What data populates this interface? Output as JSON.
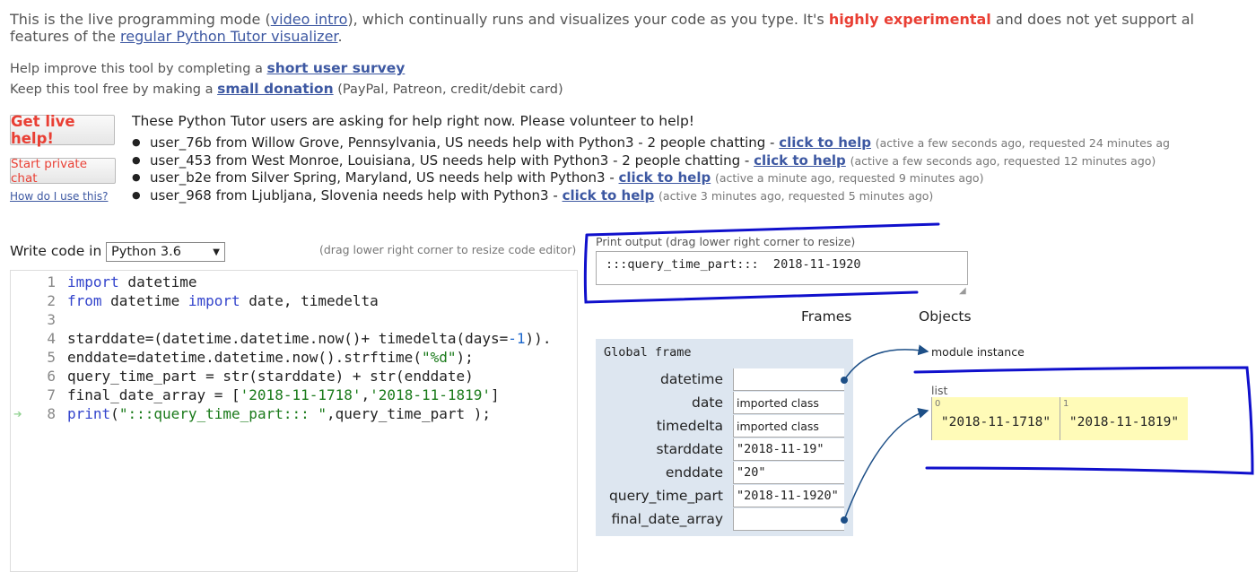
{
  "intro": {
    "prefix": "This is the live programming mode (",
    "video_link": "video intro",
    "mid": "), which continually runs and visualizes your code as you type. It's ",
    "highly": "highly experimental",
    "suffix": " and does not yet support all lang",
    "line2_prefix": "features of the ",
    "regular_link": "regular Python Tutor visualizer",
    "line2_suffix": "."
  },
  "help": {
    "survey_prefix": "Help improve this tool by completing a ",
    "survey_link": "short user survey",
    "donate_prefix": "Keep this tool free by making a ",
    "donate_link": "small donation",
    "donate_suffix": " (PayPal, Patreon, credit/debit card)"
  },
  "sidebar_buttons": {
    "live_help": "Get live help!",
    "private_chat": "Start private chat",
    "howto": "How do I use this?"
  },
  "requests": {
    "heading": "These Python Tutor users are asking for help right now. Please volunteer to help!",
    "link_label": "click to help",
    "items": [
      {
        "text": "user_76b from Willow Grove, Pennsylvania, US needs help with Python3 - 2 people chatting - ",
        "meta": "(active a few seconds ago, requested 24 minutes ag"
      },
      {
        "text": "user_453 from West Monroe, Louisiana, US needs help with Python3 - 2 people chatting - ",
        "meta": "(active a few seconds ago, requested 12 minutes ago)"
      },
      {
        "text": "user_b2e from Silver Spring, Maryland, US needs help with Python3 - ",
        "meta": "(active a minute ago, requested 9 minutes ago)"
      },
      {
        "text": "user_968 from Ljubljana, Slovenia needs help with Python3 - ",
        "meta": "(active 3 minutes ago, requested 5 minutes ago)"
      }
    ]
  },
  "editor": {
    "write_label": "Write code in",
    "language": "Python 3.6",
    "drag_hint": "(drag lower right corner to resize code editor)",
    "line_numbers": [
      "1",
      "2",
      "3",
      "4",
      "5",
      "6",
      "7",
      "8"
    ]
  },
  "output": {
    "label": "Print output (drag lower right corner to resize)",
    "text": ":::query_time_part:::  2018-11-1920"
  },
  "viz": {
    "frames_heading": "Frames",
    "objects_heading": "Objects",
    "global_frame": "Global frame",
    "vars": [
      {
        "name": "datetime",
        "value": ""
      },
      {
        "name": "date",
        "value": "imported class"
      },
      {
        "name": "timedelta",
        "value": "imported class"
      },
      {
        "name": "starddate",
        "value": "\"2018-11-19\""
      },
      {
        "name": "enddate",
        "value": "\"20\""
      },
      {
        "name": "query_time_part",
        "value": "\"2018-11-1920\""
      },
      {
        "name": "final_date_array",
        "value": ""
      }
    ],
    "module_label": "module instance",
    "list_label": "list",
    "list_items": [
      {
        "index": "0",
        "value": "\"2018-11-1718\""
      },
      {
        "index": "1",
        "value": "\"2018-11-1819\""
      }
    ]
  },
  "colors": {
    "link": "#3D58A2",
    "accent_red": "#e93f34",
    "frame_bg": "#dde6f0",
    "list_bg": "#fffbb8",
    "annotation_blue": "#1010cc"
  }
}
